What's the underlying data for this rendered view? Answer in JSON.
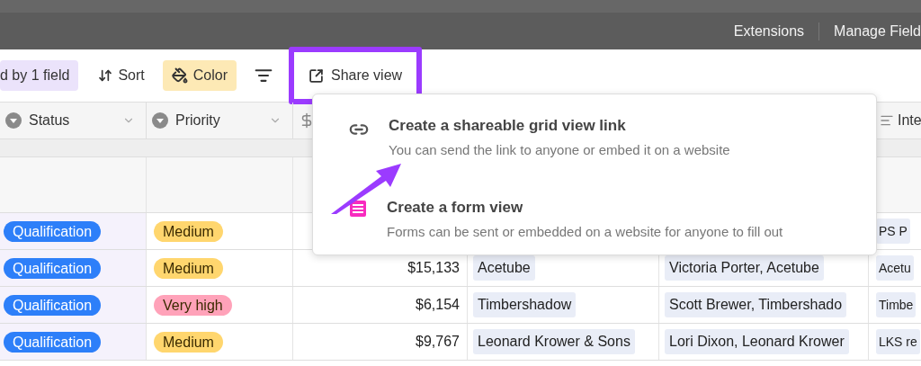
{
  "top_bar": {
    "buttons": [
      "Extensions",
      "Manage Field"
    ]
  },
  "toolbar": {
    "items": [
      {
        "kind": "group",
        "label": "d by 1 field"
      },
      {
        "kind": "sort",
        "label": "Sort"
      },
      {
        "kind": "color",
        "label": "Color"
      },
      {
        "kind": "row-height"
      },
      {
        "kind": "share",
        "label": "Share view"
      }
    ]
  },
  "table": {
    "columns": [
      {
        "label": "Status",
        "kind": "select"
      },
      {
        "label": "Priority",
        "kind": "select"
      },
      {
        "kind": "currency"
      }
    ],
    "last_column": {
      "label": "Inte"
    },
    "rows": [
      {
        "status": "Qualification",
        "priority": {
          "label": "Medium",
          "color": "#ffd66e"
        },
        "column_6": "PS P"
      },
      {
        "status": "Qualification",
        "priority": {
          "label": "Medium",
          "color": "#ffd66e"
        },
        "amount": "$15,133",
        "company": "Acetube",
        "contact": "Victoria Porter, Acetube",
        "column_6": "Acetu"
      },
      {
        "status": "Qualification",
        "priority": {
          "label": "Very high",
          "color": "#ffa2b9"
        },
        "amount": "$6,154",
        "company": "Timbershadow",
        "contact": "Scott Brewer, Timbershado",
        "column_6": "Timbe"
      },
      {
        "status": "Qualification",
        "priority": {
          "label": "Medium",
          "color": "#ffd66e"
        },
        "amount": "$9,767",
        "company": "Leonard Krower & Sons",
        "contact": "Lori Dixon, Leonard Krower",
        "column_6": "LKS re"
      }
    ]
  },
  "share_menu": {
    "items": [
      {
        "kind": "link",
        "title": "Create a shareable grid view link",
        "description": "You can send the link to anyone or embed it on a website"
      },
      {
        "kind": "form",
        "title": "Create a form view",
        "description": "Forms can be sent or embedded on a website for anyone to fill out"
      }
    ]
  }
}
